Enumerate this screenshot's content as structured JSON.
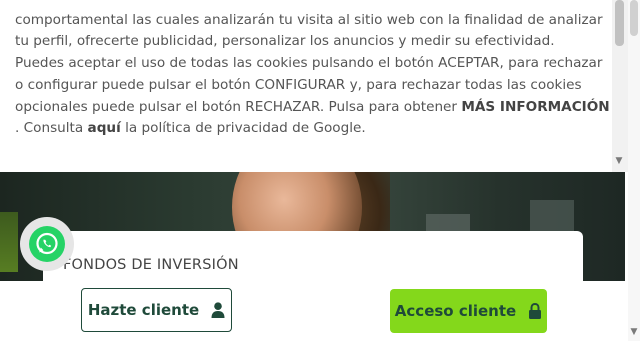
{
  "cookie_notice": {
    "lines": [
      "comportamental las cuales analizarán tu visita al sitio web con la finalidad de analizar",
      "tu perfil, ofrecerte publicidad, personalizar los anuncios y medir su efectividad.",
      "Puedes aceptar el uso de todas las cookies pulsando el botón ACEPTAR, para rechazar",
      "o configurar puede pulsar el botón CONFIGURAR y, para rechazar todas las cookies"
    ],
    "line5_prefix": "opcionales puede pulsar el botón RECHAZAR. Pulsa para obtener ",
    "more_info_link": "MÁS INFORMACIÓN",
    "line6_prefix": " . Consulta ",
    "here_link": "aquí",
    "line6_suffix": " la política de privacidad de Google."
  },
  "hero": {
    "card_title": "FONDOS DE INVERSIÓN"
  },
  "bottom_bar": {
    "hazte_cliente_label": "Hazte cliente",
    "acceso_cliente_label": "Acceso cliente"
  },
  "colors": {
    "brand_dark_green": "#1f4a3a",
    "accent_lime": "#84d81b",
    "whatsapp_green": "#25d366"
  },
  "icons": [
    "whatsapp-icon",
    "user-icon",
    "lock-icon",
    "chevron-down-icon"
  ]
}
